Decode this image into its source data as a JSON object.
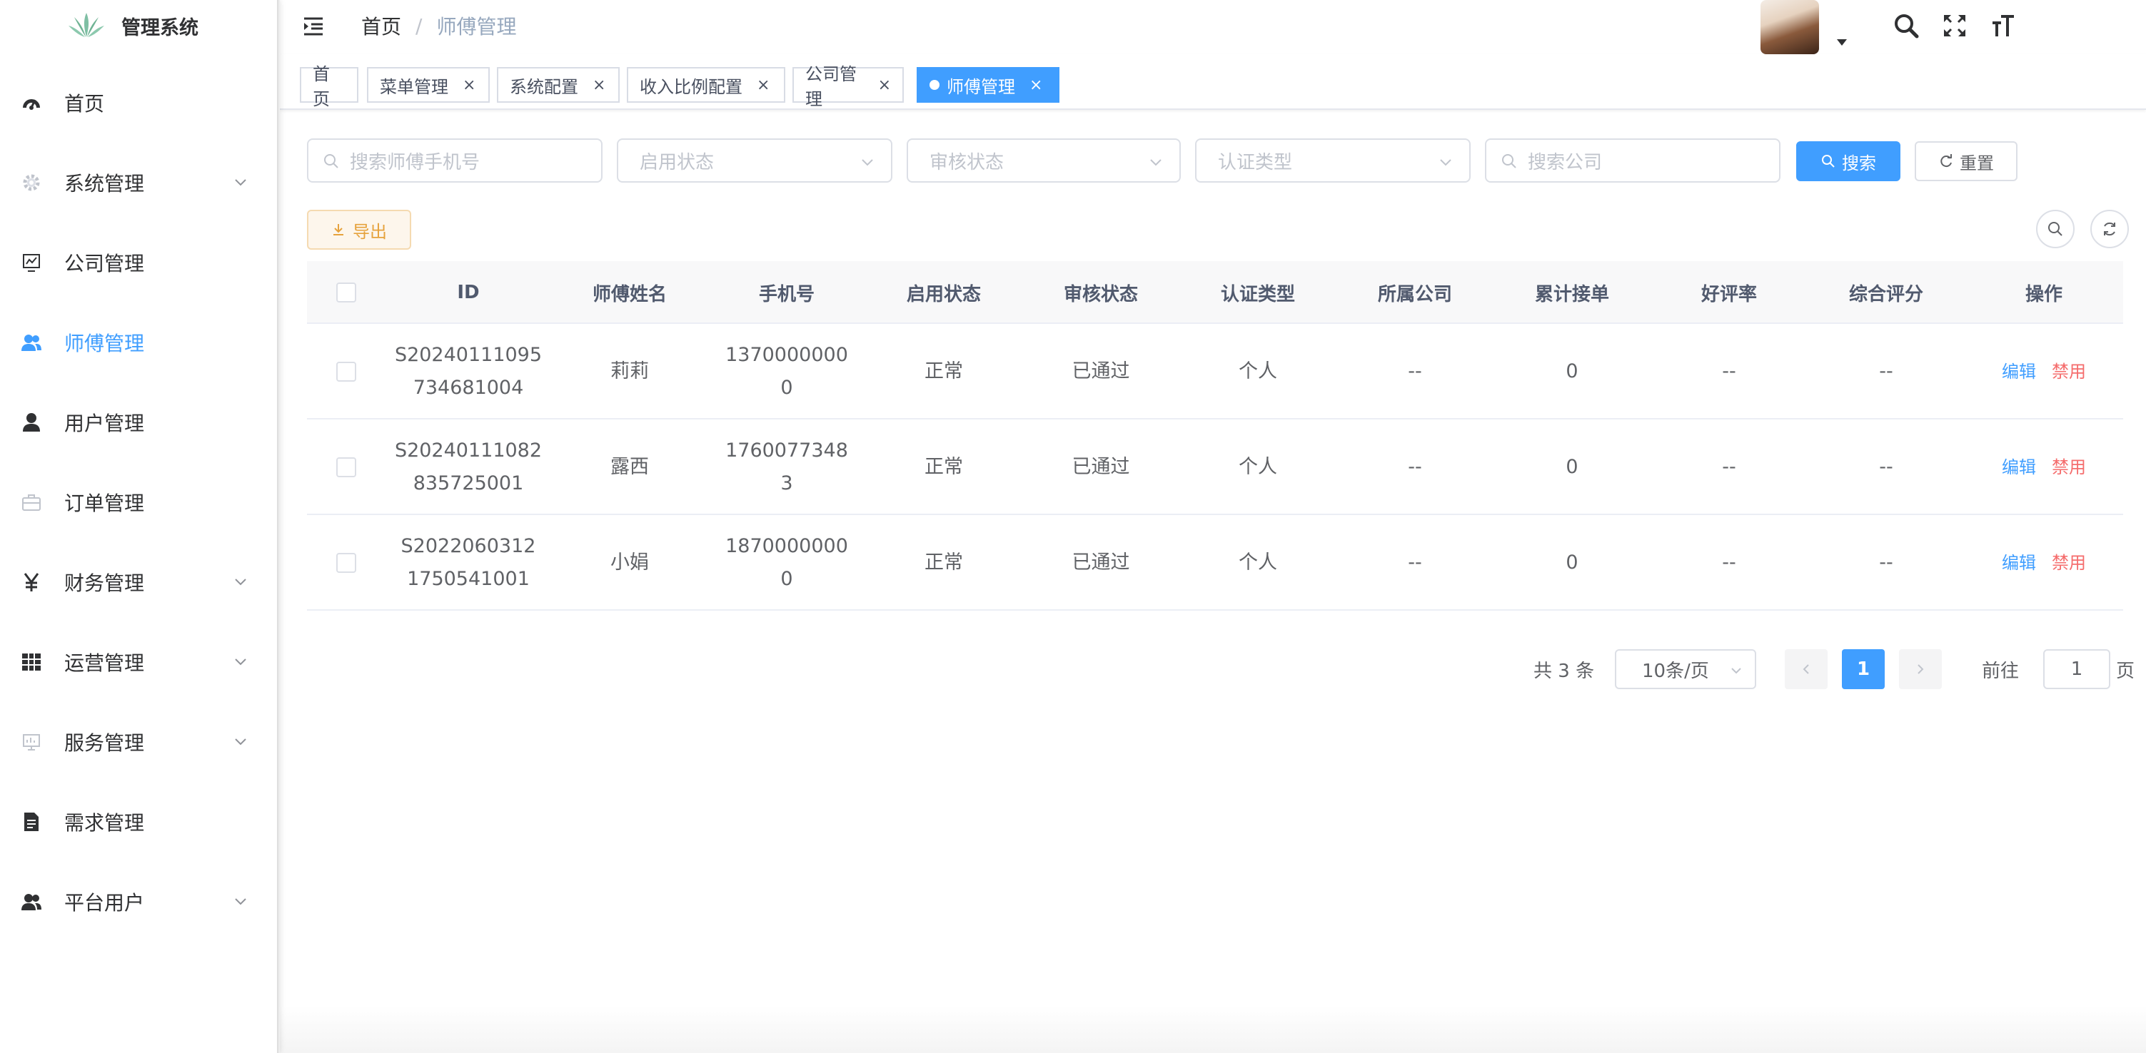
{
  "app": {
    "title": "管理系统"
  },
  "colors": {
    "primary": "#409eff",
    "danger": "#f56c6c",
    "warning": "#e6a23c",
    "text": "#303133",
    "muted": "#c0c4cc"
  },
  "sidebar": {
    "items": [
      {
        "label": "首页",
        "icon": "dashboard-icon",
        "expandable": false,
        "active": false
      },
      {
        "label": "系统管理",
        "icon": "gear-icon",
        "expandable": true,
        "active": false
      },
      {
        "label": "公司管理",
        "icon": "chart-monitor-icon",
        "expandable": false,
        "active": false
      },
      {
        "label": "师傅管理",
        "icon": "peoples-icon",
        "expandable": false,
        "active": true
      },
      {
        "label": "用户管理",
        "icon": "user-icon",
        "expandable": false,
        "active": false
      },
      {
        "label": "订单管理",
        "icon": "briefcase-icon",
        "expandable": false,
        "active": false
      },
      {
        "label": "财务管理",
        "icon": "yen-icon",
        "expandable": true,
        "active": false
      },
      {
        "label": "运营管理",
        "icon": "grid-icon",
        "expandable": true,
        "active": false
      },
      {
        "label": "服务管理",
        "icon": "monitor-icon",
        "expandable": true,
        "active": false
      },
      {
        "label": "需求管理",
        "icon": "document-icon",
        "expandable": false,
        "active": false
      },
      {
        "label": "平台用户",
        "icon": "peoples-icon",
        "expandable": true,
        "active": false
      }
    ]
  },
  "header": {
    "breadcrumb": {
      "home": "首页",
      "separator": "/",
      "current": "师傅管理"
    },
    "icons": [
      "search-icon",
      "fullscreen-icon",
      "font-size-icon"
    ]
  },
  "tags": [
    {
      "label": "首页",
      "closable": false,
      "active": false
    },
    {
      "label": "菜单管理",
      "closable": true,
      "active": false
    },
    {
      "label": "系统配置",
      "closable": true,
      "active": false
    },
    {
      "label": "收入比例配置",
      "closable": true,
      "active": false
    },
    {
      "label": "公司管理",
      "closable": true,
      "active": false
    },
    {
      "label": "师傅管理",
      "closable": true,
      "active": true
    }
  ],
  "tag_close": "×",
  "filters": {
    "phone_placeholder": "搜索师傅手机号",
    "enable_status_placeholder": "启用状态",
    "review_status_placeholder": "审核状态",
    "auth_type_placeholder": "认证类型",
    "company_placeholder": "搜索公司",
    "search_label": "搜索",
    "reset_label": "重置"
  },
  "toolbar": {
    "export_label": "导出"
  },
  "table": {
    "columns": [
      "ID",
      "师傅姓名",
      "手机号",
      "启用状态",
      "审核状态",
      "认证类型",
      "所属公司",
      "累计接单",
      "好评率",
      "综合评分",
      "操作"
    ],
    "rows": [
      {
        "id_line1": "S20240111095",
        "id_line2": "734681004",
        "name": "莉莉",
        "phone_line1": "1370000000",
        "phone_line2": "0",
        "enable": "正常",
        "review": "已通过",
        "auth": "个人",
        "company": "--",
        "orders": "0",
        "rate": "--",
        "score": "--"
      },
      {
        "id_line1": "S20240111082",
        "id_line2": "835725001",
        "name": "露西",
        "phone_line1": "1760077348",
        "phone_line2": "3",
        "enable": "正常",
        "review": "已通过",
        "auth": "个人",
        "company": "--",
        "orders": "0",
        "rate": "--",
        "score": "--"
      },
      {
        "id_line1": "S2022060312",
        "id_line2": "1750541001",
        "name": "小娟",
        "phone_line1": "1870000000",
        "phone_line2": "0",
        "enable": "正常",
        "review": "已通过",
        "auth": "个人",
        "company": "--",
        "orders": "0",
        "rate": "--",
        "score": "--"
      }
    ],
    "actions": {
      "edit": "编辑",
      "disable": "禁用"
    }
  },
  "pagination": {
    "total_text": "共 3 条",
    "page_size": "10条/页",
    "current_page": "1",
    "goto_label": "前往",
    "goto_value": "1",
    "page_suffix": "页"
  }
}
